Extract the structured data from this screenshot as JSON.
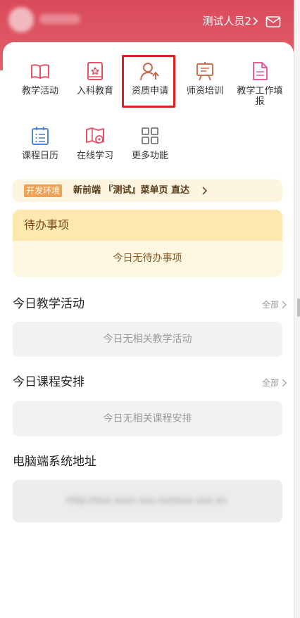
{
  "header": {
    "user_name": "测试人员2",
    "icons": [
      "chevron-right-icon",
      "mail-icon"
    ],
    "background_color": "#d94a5a"
  },
  "shortcuts": [
    {
      "label": "教学活动",
      "icon": "book-icon"
    },
    {
      "label": "入科教育",
      "icon": "bookmark-badge-icon"
    },
    {
      "label": "资质申请",
      "icon": "user-upload-icon"
    },
    {
      "label": "师资培训",
      "icon": "training-board-icon"
    },
    {
      "label": "教学工作填报",
      "icon": "document-icon"
    },
    {
      "label": "课程日历",
      "icon": "list-calendar-icon"
    },
    {
      "label": "在线学习",
      "icon": "map-study-icon"
    },
    {
      "label": "更多功能",
      "icon": "grid-icon"
    }
  ],
  "env_bar": {
    "tag": "开发环境",
    "text": "新前端 『测试』菜单页 直达"
  },
  "todo": {
    "title": "待办事项",
    "empty": "今日无待办事项"
  },
  "today_activities": {
    "title": "今日教学活动",
    "all_label": "全部",
    "empty": "今日无相关教学活动"
  },
  "today_courses": {
    "title": "今日课程安排",
    "all_label": "全部",
    "empty": "今日无相关课程安排"
  },
  "pc_address": {
    "title": "电脑端系统地址",
    "url": "http://xxx.xxxx.xxx.xx/xxxx.xxx.xx"
  },
  "colors": {
    "accent_red": "#e02020",
    "tag_orange": "#f2a152",
    "todo_header": "#fde8ae"
  }
}
